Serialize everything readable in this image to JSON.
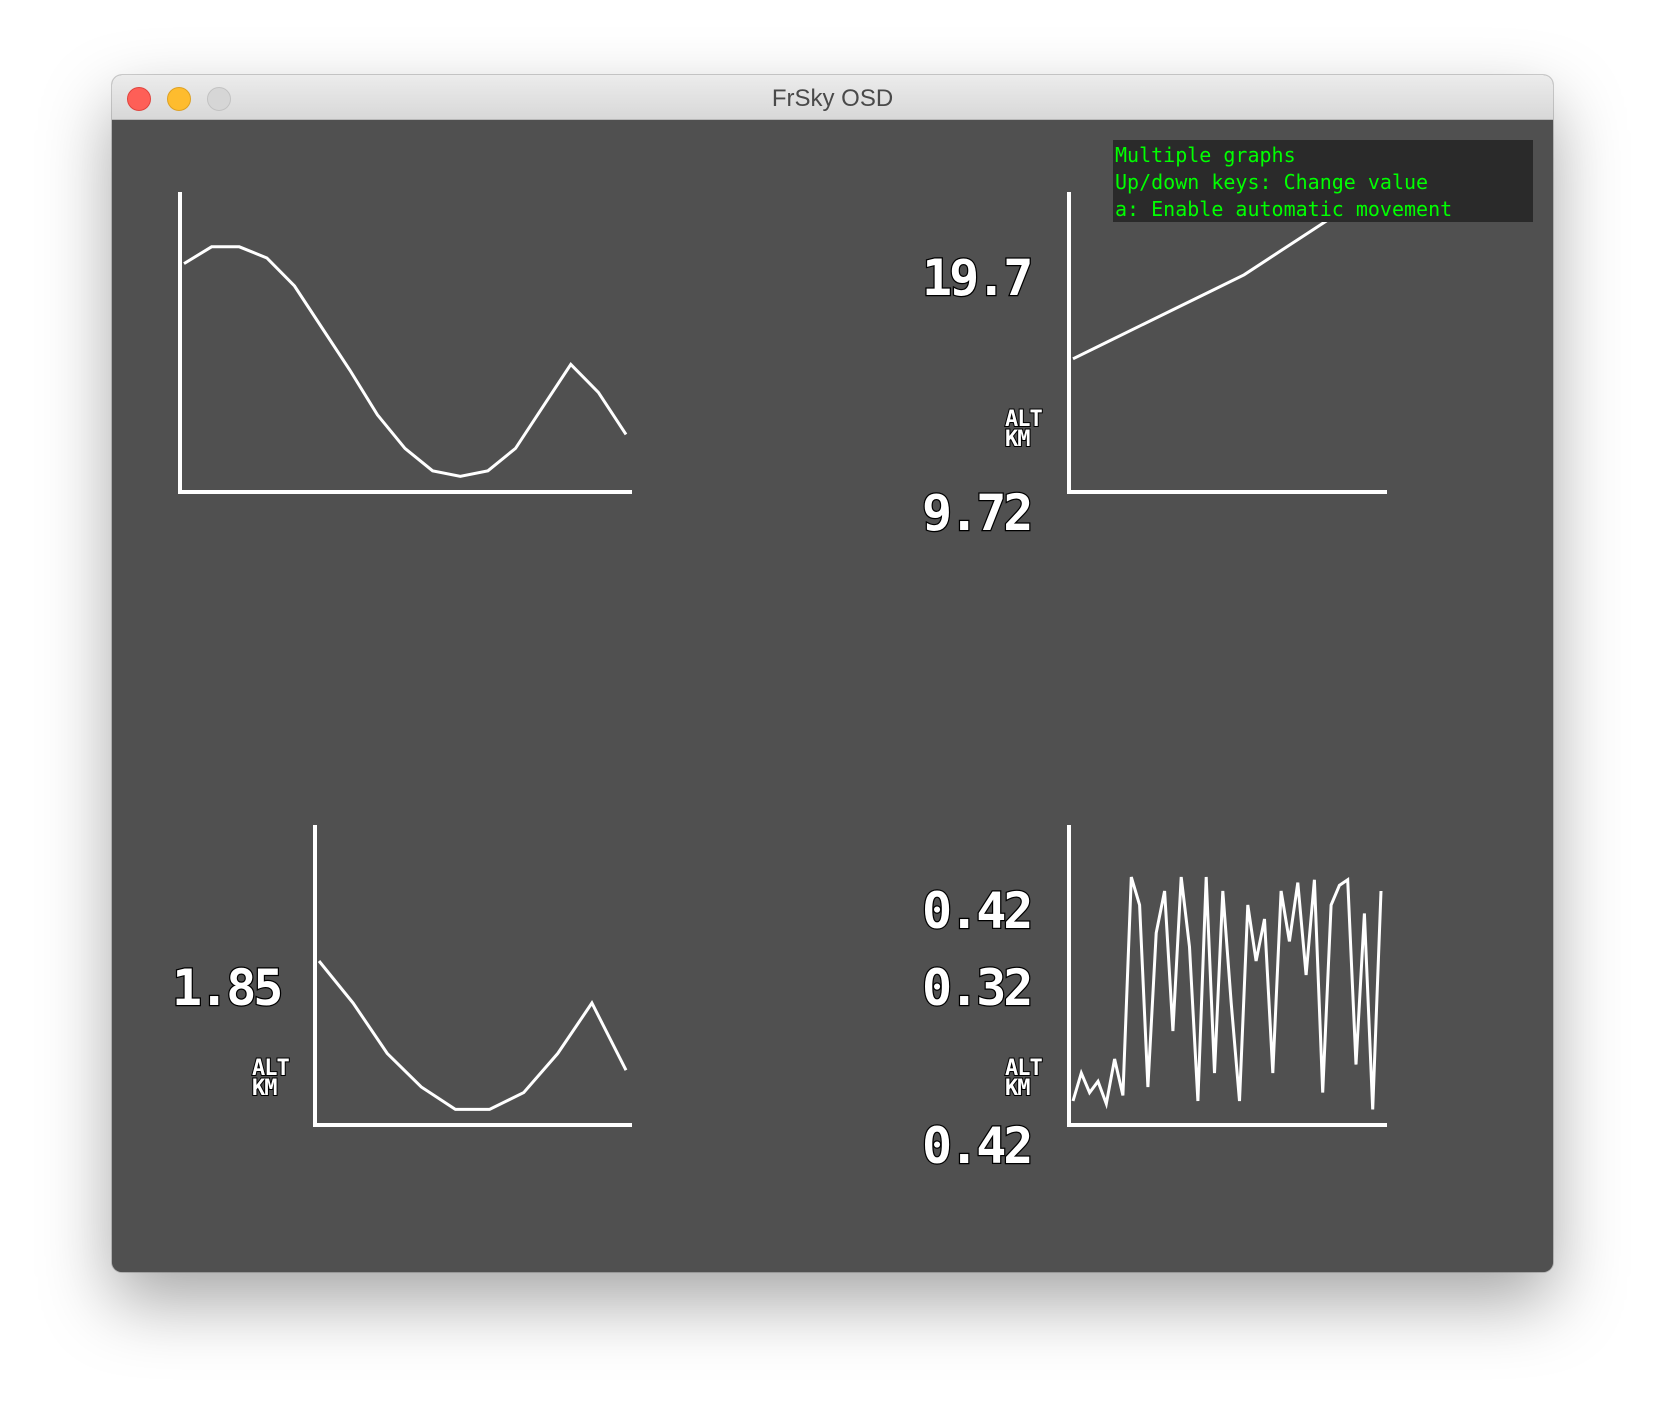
{
  "window": {
    "title": "FrSky OSD"
  },
  "help": {
    "lines": [
      "Multiple graphs",
      "Up/down keys: Change value",
      "a: Enable automatic movement"
    ],
    "color": "#00ff00",
    "background": "#2a2a2a"
  },
  "colors": {
    "canvas": "#505050",
    "trace": "#ffffff",
    "outline": "#000000"
  },
  "graphs": {
    "top_left": {
      "labels": [],
      "series": [
        0.78,
        0.84,
        0.84,
        0.8,
        0.7,
        0.55,
        0.4,
        0.24,
        0.12,
        0.04,
        0.02,
        0.04,
        0.12,
        0.27,
        0.42,
        0.32,
        0.17
      ]
    },
    "top_right": {
      "max_label": "19.7",
      "min_label": "9.72",
      "unit_top": "ALT",
      "unit_bottom": "KM",
      "series": [
        0.44,
        0.5,
        0.56,
        0.62,
        0.68,
        0.74,
        0.82,
        0.9,
        0.98,
        1.0
      ]
    },
    "bottom_left": {
      "value_label": "1.85",
      "unit_top": "ALT",
      "unit_bottom": "KM",
      "series": [
        0.55,
        0.4,
        0.22,
        0.1,
        0.02,
        0.02,
        0.08,
        0.22,
        0.4,
        0.16
      ]
    },
    "bottom_right": {
      "max_label": "0.42",
      "mid_label": "0.32",
      "min_label": "0.42",
      "unit_top": "ALT",
      "unit_bottom": "KM",
      "series": [
        0.05,
        0.15,
        0.08,
        0.12,
        0.04,
        0.2,
        0.07,
        0.85,
        0.75,
        0.1,
        0.65,
        0.8,
        0.3,
        0.85,
        0.6,
        0.05,
        0.85,
        0.15,
        0.8,
        0.4,
        0.05,
        0.75,
        0.55,
        0.7,
        0.15,
        0.8,
        0.62,
        0.83,
        0.5,
        0.84,
        0.08,
        0.75,
        0.82,
        0.84,
        0.18,
        0.72,
        0.02,
        0.8
      ]
    }
  }
}
